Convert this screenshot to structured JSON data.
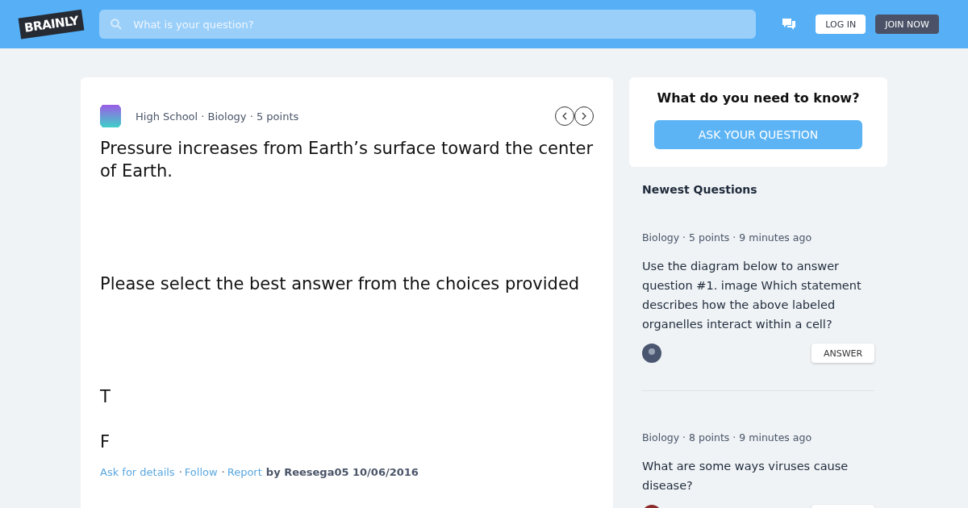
{
  "header": {
    "logo": "BRAINLY",
    "search": {
      "placeholder": "What is your question?"
    },
    "buttons": [
      {
        "kind": "light",
        "label": "LOG IN"
      },
      {
        "kind": "dark",
        "label": "JOIN NOW"
      }
    ]
  },
  "question": {
    "meta": "High School · Biology · 5 points",
    "paragraphs": [
      "Pressure increases from Earth’s surface toward the center of Earth.",
      "Please select the best answer from the choices provided",
      "T",
      "F"
    ],
    "links": [
      {
        "kind": "link",
        "text": "Ask for details"
      },
      {
        "kind": "separator",
        "text": "·"
      },
      {
        "kind": "link",
        "text": "Follow"
      },
      {
        "kind": "separator",
        "text": "·"
      },
      {
        "kind": "link",
        "text": "Report"
      }
    ],
    "byline": "by Reesega05 10/06/2016"
  },
  "ask": {
    "title": "What do you need to know?",
    "button": "ASK YOUR QUESTION"
  },
  "newest": {
    "title": "Newest Questions",
    "items": [
      {
        "meta": "Biology · 5 points · 9 minutes ago",
        "text": "Use the diagram below to answer question #1. image Which statement describes how the above labeled organelles interact within a cell?",
        "color": "#4a5670",
        "answer": "ANSWER"
      },
      {
        "meta": "Biology · 8 points · 9 minutes ago",
        "text": "What are some ways viruses cause disease?",
        "color": "#8b2a2a"
      }
    ]
  }
}
